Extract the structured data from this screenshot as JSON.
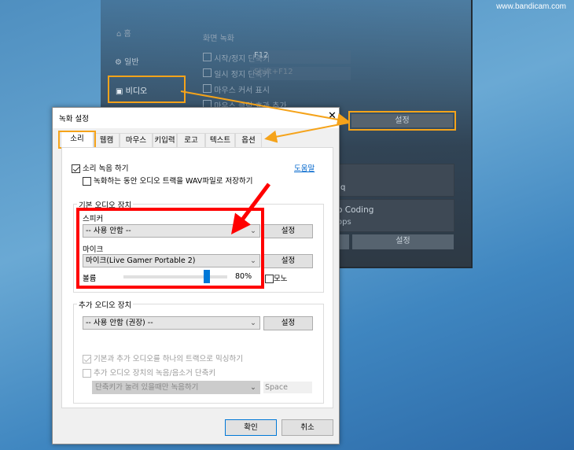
{
  "watermark": "www.bandicam.com",
  "background_app": {
    "sidebar": [
      {
        "label": "홈",
        "icon": "home-icon"
      },
      {
        "label": "일반",
        "icon": "gear-icon"
      },
      {
        "label": "비디오",
        "icon": "video-settings-icon"
      }
    ],
    "section_title": "화면 녹화",
    "options": [
      {
        "label": "시작/정지 단축키",
        "checked": true,
        "value": "F12"
      },
      {
        "label": "일시 정지 단축키",
        "checked": false,
        "value": "Shift+F12"
      },
      {
        "label": "마우스 커서 표시",
        "checked": false
      },
      {
        "label": "마우스 클릭 효과 추가",
        "checked": false
      }
    ],
    "settings_button": "설정",
    "format_line1": "q",
    "format_line2": "o Coding",
    "format_line3": "ops",
    "settings_button_2": "설정"
  },
  "dialog": {
    "title": "녹화 설정",
    "tabs": [
      "소리",
      "웹캠",
      "마우스",
      "키입력",
      "로고",
      "텍스트",
      "옵션"
    ],
    "active_tab": "소리",
    "record_sound": {
      "label": "소리 녹음 하기",
      "checked": true
    },
    "save_wav": {
      "label": "녹화하는 동안 오디오 트랙을 WAV파일로 저장하기",
      "checked": false
    },
    "help_link": "도움말",
    "primary_group": {
      "title": "기본 오디오 장치",
      "speaker_label": "스피커",
      "speaker_value": "-- 사용 안함 --",
      "speaker_settings": "설정",
      "mic_label": "마이크",
      "mic_value": "마이크(Live Gamer Portable 2)",
      "mic_settings": "설정",
      "volume_label": "볼륨",
      "volume_percent": 80,
      "volume_text": "80%",
      "mono": {
        "label": "모노",
        "checked": false
      }
    },
    "secondary_group": {
      "title": "추가 오디오 장치",
      "device_value": "-- 사용 안함 (권장) --",
      "device_settings": "설정",
      "mix": {
        "label": "기본과 추가 오디오를 하나의 트랙으로 믹싱하기",
        "checked": true,
        "disabled": true
      },
      "hotkey": {
        "label": "추가 오디오 장치의 녹음/음소거 단축키",
        "checked": false
      },
      "hotkey_mode": "단축키가 눌려 있을때만 녹음하기",
      "hotkey_key": "Space"
    },
    "ok": "확인",
    "cancel": "취소"
  },
  "colors": {
    "highlight_orange": "#f5a31a",
    "callout_red": "#ff0000",
    "link_blue": "#0066cc",
    "slider_thumb": "#0078d7"
  }
}
